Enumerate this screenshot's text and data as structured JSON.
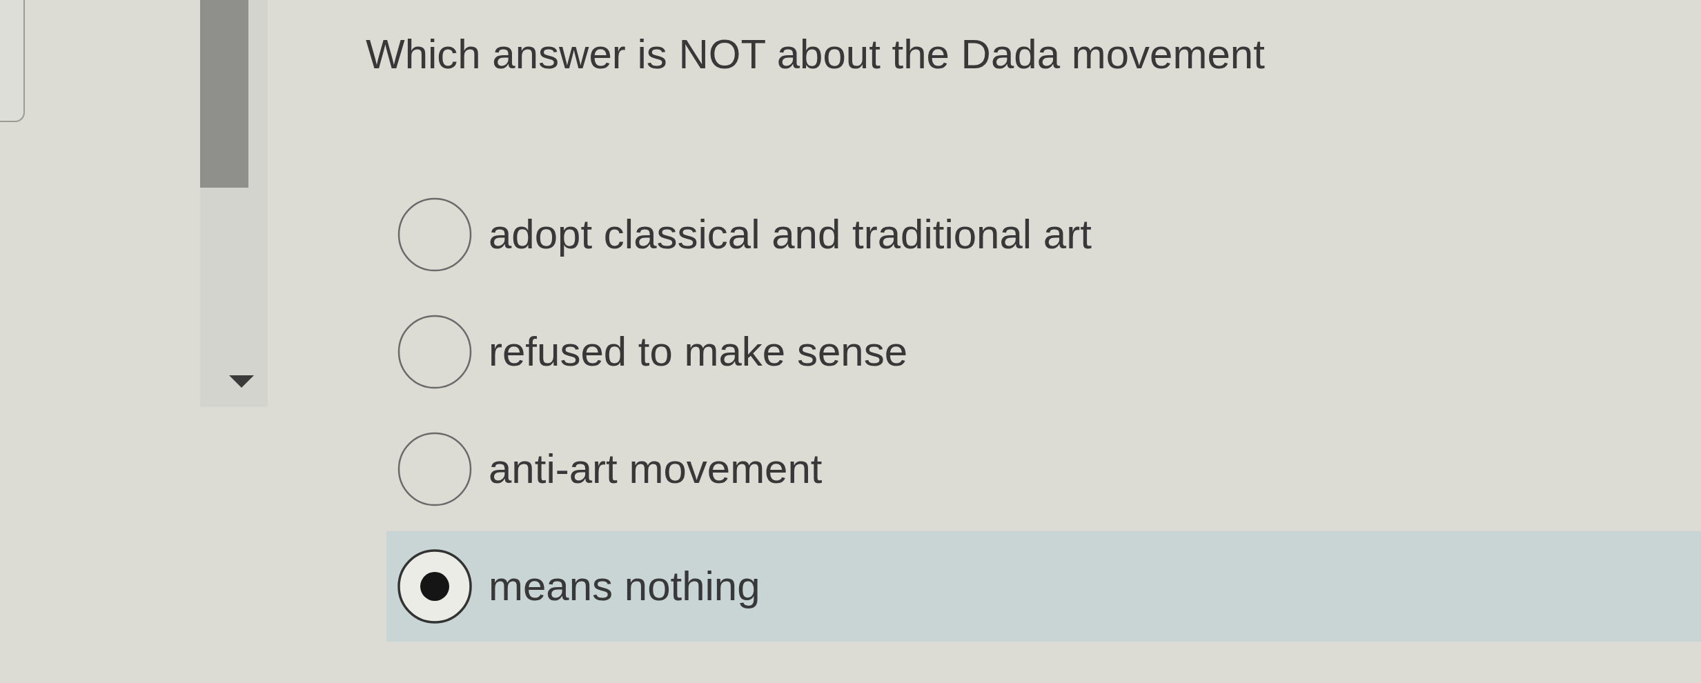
{
  "question": {
    "text": "Which answer is NOT about the Dada movement"
  },
  "options": [
    {
      "label": "adopt classical and traditional art",
      "selected": false
    },
    {
      "label": "refused to make sense",
      "selected": false
    },
    {
      "label": "anti-art movement",
      "selected": false
    },
    {
      "label": "means nothing",
      "selected": true
    }
  ]
}
